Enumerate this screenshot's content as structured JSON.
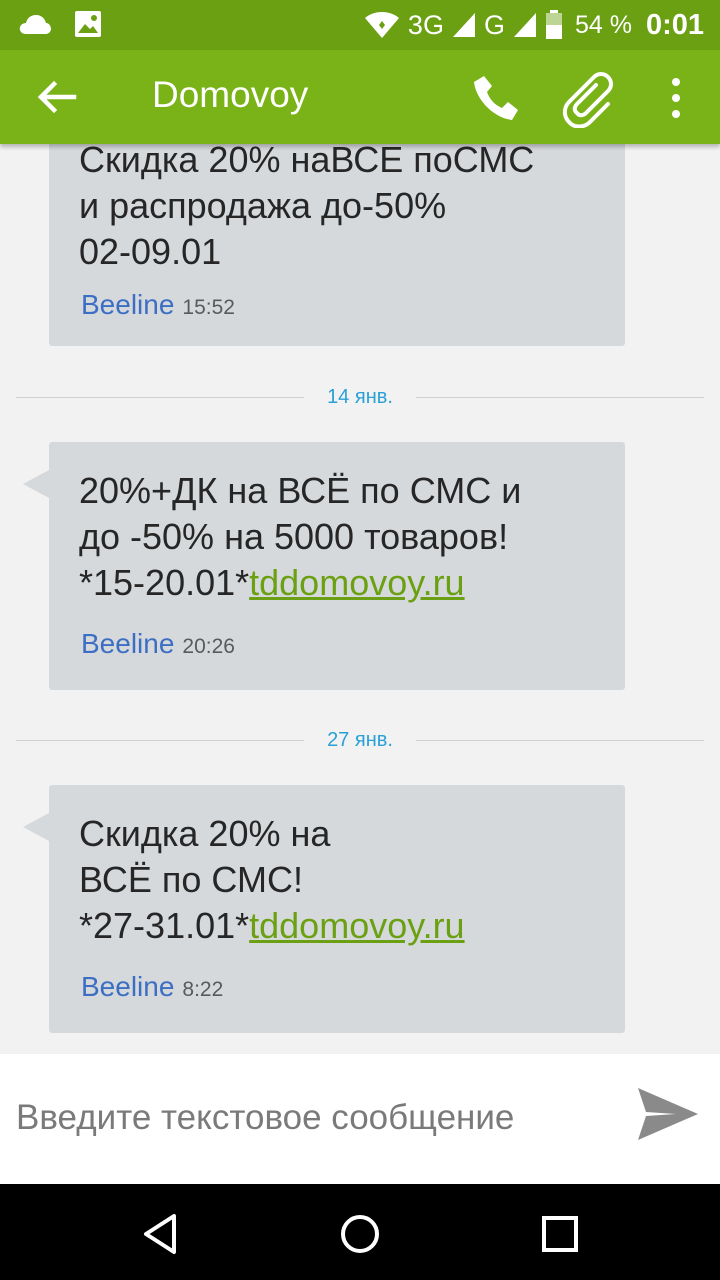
{
  "status_bar": {
    "network": "3G",
    "network2": "G",
    "battery_pct": "54 %",
    "time": "0:01"
  },
  "app_bar": {
    "title": "Domovoy"
  },
  "messages": [
    {
      "lines": [
        "Скидка 20% наВСЕ поСМС",
        "и распродажа до-50%",
        "02-09.01"
      ],
      "sender": "Beeline",
      "time": "15:52"
    },
    {
      "date": "14 янв.",
      "lines": [
        "20%+ДК на ВСЁ по СМС и",
        "до -50% на 5000 товаров!",
        "*15-20.01*"
      ],
      "link": "tddomovoy.ru",
      "sender": "Beeline",
      "time": "20:26"
    },
    {
      "date": "27 янв.",
      "lines": [
        "Скидка 20% на",
        "ВСЁ по СМС!",
        "*27-31.01*"
      ],
      "link": "tddomovoy.ru",
      "sender": "Beeline",
      "time": "8:22"
    }
  ],
  "composer": {
    "placeholder": "Введите текстовое сообщение"
  },
  "colors": {
    "status_bar": "#6aa012",
    "app_bar": "#7ab317",
    "bubble": "#d6d9dc",
    "sender": "#3c6fc3",
    "date": "#2ba0d6",
    "link": "#6aa012"
  }
}
